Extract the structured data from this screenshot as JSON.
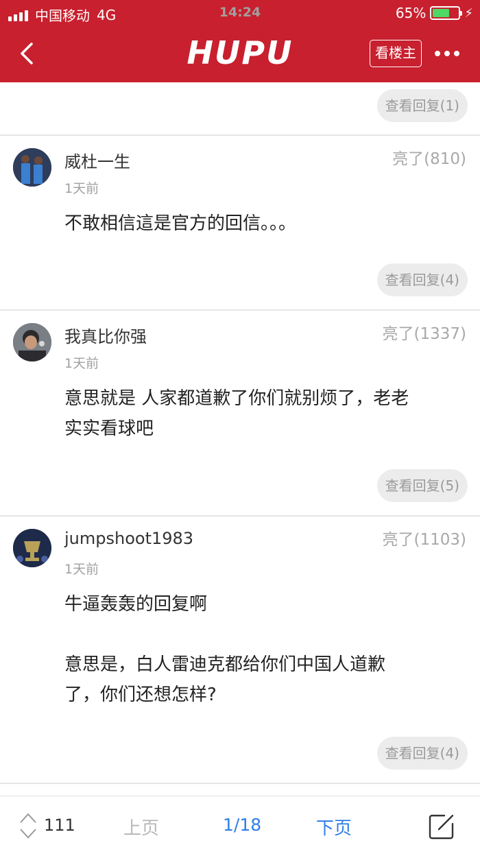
{
  "status": {
    "carrier": "中国移动",
    "network": "4G",
    "time": "14:24",
    "battery": "65%",
    "battery_level": 0.65
  },
  "header": {
    "logo": "HUPU",
    "op_button": "看楼主",
    "back_icon": "chevron-left-icon",
    "more_icon": "more-dots-icon"
  },
  "top_reply_button": "查看回复(1)",
  "posts": [
    {
      "user": "威杜一生",
      "time": "1天前",
      "likes": "亮了(810)",
      "lines": [
        "不敢相信這是官方的回信。。。"
      ],
      "reply_button": "查看回复(4)"
    },
    {
      "user": "我真比你强",
      "time": "1天前",
      "likes": "亮了(1337)",
      "lines": [
        "意思就是 人家都道歉了你们就别烦了，老老",
        "实实看球吧"
      ],
      "reply_button": "查看回复(5)"
    },
    {
      "user": "jumpshoot1983",
      "time": "1天前",
      "likes": "亮了(1103)",
      "lines": [
        "牛逼轰轰的回复啊",
        "",
        "意思是，白人雷迪克都给你们中国人道歉",
        "了，你们还想怎样?"
      ],
      "reply_button": "查看回复(4)"
    }
  ],
  "footer": {
    "vote_count": "111",
    "prev": "上页",
    "pager": "1/18",
    "next": "下页",
    "compose_icon": "compose-icon",
    "vote_icon": "vote-arrows-icon"
  },
  "colors": {
    "brand_red": "#c8202e",
    "link_blue": "#2f7ee8"
  }
}
